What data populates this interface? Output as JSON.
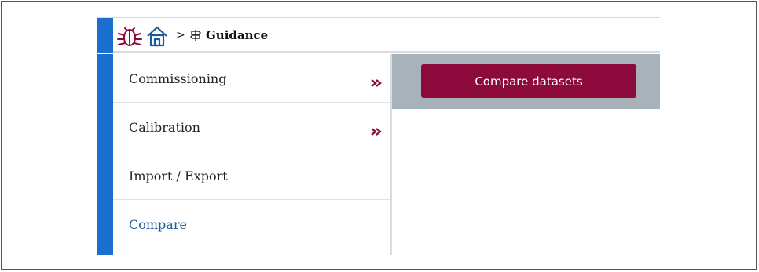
{
  "colors": {
    "accent_blue": "#1a6fce",
    "brand_maroon": "#8c0a3c",
    "content_bar": "#a8b2bb"
  },
  "header": {
    "logo_icon": "bug-icon",
    "home_icon": "home-icon",
    "separator": ">",
    "breadcrumb_icon": "signpost-icon",
    "breadcrumb_label": "Guidance"
  },
  "menu": {
    "items": [
      {
        "label": "Commissioning",
        "has_submenu": true,
        "active": false
      },
      {
        "label": "Calibration",
        "has_submenu": true,
        "active": false
      },
      {
        "label": "Import / Export",
        "has_submenu": false,
        "active": false
      },
      {
        "label": "Compare",
        "has_submenu": false,
        "active": true
      }
    ]
  },
  "content": {
    "compare_button_label": "Compare datasets"
  }
}
